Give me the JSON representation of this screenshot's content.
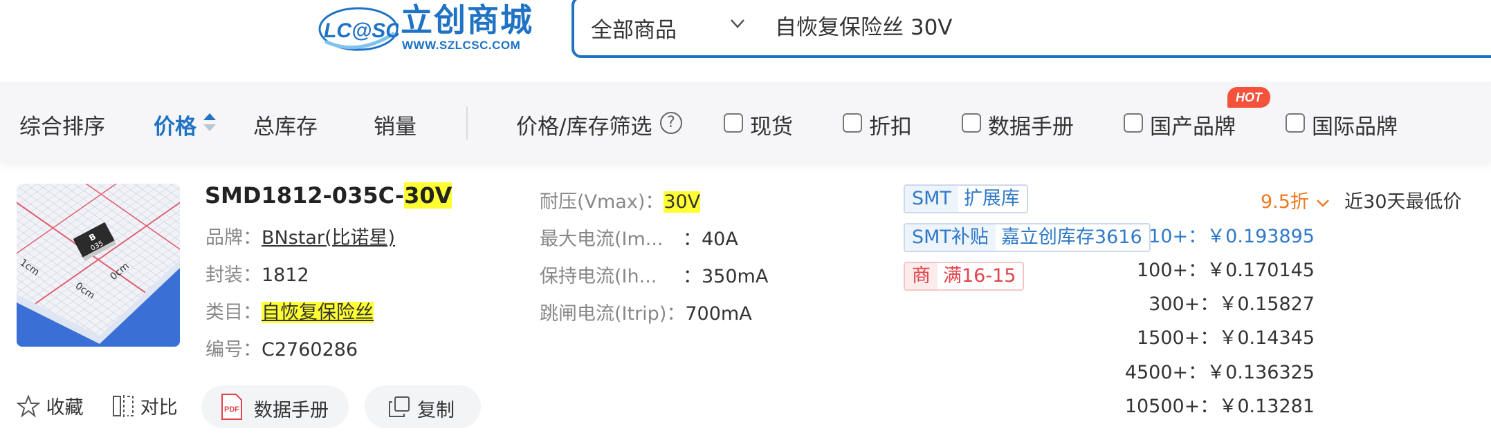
{
  "header": {
    "logo_mark": "LC@SC",
    "logo_cn": "立创商城",
    "logo_url": "WWW.SZLCSC.COM",
    "search_category": "全部商品",
    "search_value": "自恢复保险丝 30V"
  },
  "sortbar": {
    "items": [
      "综合排序",
      "价格",
      "总库存",
      "销量"
    ],
    "active": "价格",
    "filter_label": "价格/库存筛选",
    "help_icon": "?",
    "checkboxes": [
      "现货",
      "折扣",
      "数据手册",
      "国产品牌",
      "国际品牌"
    ],
    "hot_badge": "HOT"
  },
  "product": {
    "title_prefix": "SMD1812-035C-",
    "title_highlight": "30V",
    "image_markings": [
      "B",
      "035",
      "1cm",
      "0cm",
      "0cm"
    ],
    "attrs": [
      {
        "key": "品牌：",
        "value": "BNstar(比诺星)"
      },
      {
        "key": "封装：",
        "value": "1812"
      },
      {
        "key": "类目：",
        "value": "自恢复保险丝"
      },
      {
        "key": "编号：",
        "value": "C2760286"
      }
    ],
    "specs": [
      {
        "key": "耐压(Vmax)：",
        "value": "30V"
      },
      {
        "key": "最大电流(Im...",
        "value": "：40A"
      },
      {
        "key": "保持电流(Ih...",
        "value": "：350mA"
      },
      {
        "key": "跳闸电流(Itrip)：",
        "value": "700mA"
      }
    ],
    "tags": [
      {
        "a": "SMT",
        "b": "扩展库"
      },
      {
        "a": "SMT补贴",
        "b": "嘉立创库存3616"
      },
      {
        "a": "商",
        "b": "满16-15"
      }
    ],
    "discount": "9.5折",
    "lowest_label": "近30天最低价",
    "prices": [
      {
        "qty": "10+：",
        "price": "￥0.193895"
      },
      {
        "qty": "100+：",
        "price": "￥0.170145"
      },
      {
        "qty": "300+：",
        "price": "￥0.15827"
      },
      {
        "qty": "1500+：",
        "price": "￥0.14345"
      },
      {
        "qty": "4500+：",
        "price": "￥0.136325"
      },
      {
        "qty": "10500+：",
        "price": "￥0.13281"
      }
    ],
    "actions": {
      "favorite": "收藏",
      "compare": "对比",
      "datasheet": "数据手册",
      "pdf_icon": "PDF",
      "copy": "复制"
    }
  },
  "colors": {
    "brand_blue": "#1f72c4",
    "highlight": "#ffff33",
    "discount_orange": "#f07820",
    "hot_red": "#f5523b"
  }
}
